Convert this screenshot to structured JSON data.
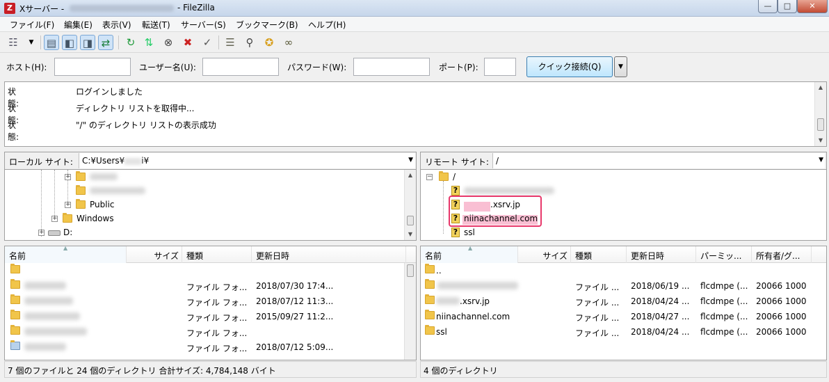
{
  "window": {
    "app_icon": "Z",
    "title_prefix": "Xサーバー -",
    "title_suffix": "- FileZilla",
    "minimize": "—",
    "maximize": "□",
    "close": "✕"
  },
  "menu": [
    "ファイル(F)",
    "編集(E)",
    "表示(V)",
    "転送(T)",
    "サーバー(S)",
    "ブックマーク(B)",
    "ヘルプ(H)"
  ],
  "toolbar": {
    "icons": [
      "site-manager-icon",
      "message-log-icon",
      "local-tree-icon",
      "remote-tree-icon",
      "transfer-queue-icon",
      "refresh-icon",
      "process-queue-icon",
      "cancel-icon",
      "disconnect-icon",
      "reconnect-icon",
      "directory-filter-icon",
      "compare-icon",
      "sync-browse-icon",
      "search-icon"
    ]
  },
  "quickconnect": {
    "host_label": "ホスト(H):",
    "user_label": "ユーザー名(U):",
    "password_label": "パスワード(W):",
    "port_label": "ポート(P):",
    "button": "クイック接続(Q)",
    "dropdown": "▼"
  },
  "log": [
    {
      "type": "状態:",
      "text": "ログインしました"
    },
    {
      "type": "状態:",
      "text": "ディレクトリ リストを取得中..."
    },
    {
      "type": "状態:",
      "text": "\"/\" のディレクトリ リストの表示成功"
    }
  ],
  "local": {
    "site_label": "ローカル サイト:",
    "path": "C:¥Users¥",
    "path_end": "i¥",
    "tree": {
      "public": "Public",
      "windows": "Windows",
      "drive_d": "D:"
    },
    "columns": [
      "名前",
      "サイズ",
      "種類",
      "更新日時"
    ],
    "rows": [
      {
        "type": "",
        "date": ""
      },
      {
        "type": "ファイル フォ...",
        "date": "2018/07/30 17:4..."
      },
      {
        "type": "ファイル フォ...",
        "date": "2018/07/12 11:3..."
      },
      {
        "type": "ファイル フォ...",
        "date": "2015/09/27 11:2..."
      },
      {
        "type": "ファイル フォ...",
        "date": ""
      },
      {
        "type": "ファイル フォ...",
        "date": "2018/07/12 5:09..."
      }
    ],
    "status": "7 個のファイルと 24 個のディレクトリ 合計サイズ: 4,784,148 バイト"
  },
  "remote": {
    "site_label": "リモート サイト:",
    "path": "/",
    "tree": {
      "root": "/",
      "domain1": ".xsrv.jp",
      "domain2": "niinachannel.com",
      "ssl": "ssl"
    },
    "columns": [
      "名前",
      "サイズ",
      "種類",
      "更新日時",
      "パーミッ...",
      "所有者/グ..."
    ],
    "rows": [
      {
        "name": "..",
        "type": "",
        "date": "",
        "perm": "",
        "owner": ""
      },
      {
        "name": "",
        "type": "ファイル ...",
        "date": "2018/06/19 ...",
        "perm": "flcdmpe (...",
        "owner": "20066 1000"
      },
      {
        "name": ".xsrv.jp",
        "type": "ファイル ...",
        "date": "2018/04/24 ...",
        "perm": "flcdmpe (...",
        "owner": "20066 1000"
      },
      {
        "name": "niinachannel.com",
        "type": "ファイル ...",
        "date": "2018/04/27 ...",
        "perm": "flcdmpe (...",
        "owner": "20066 1000"
      },
      {
        "name": "ssl",
        "type": "ファイル ...",
        "date": "2018/04/24 ...",
        "perm": "flcdmpe (...",
        "owner": "20066 1000"
      }
    ],
    "status": "4 個のディレクトリ"
  },
  "colors": {
    "highlight": "#e8386b",
    "folder": "#f1c54a",
    "button_accent": "#3c7fb1"
  }
}
